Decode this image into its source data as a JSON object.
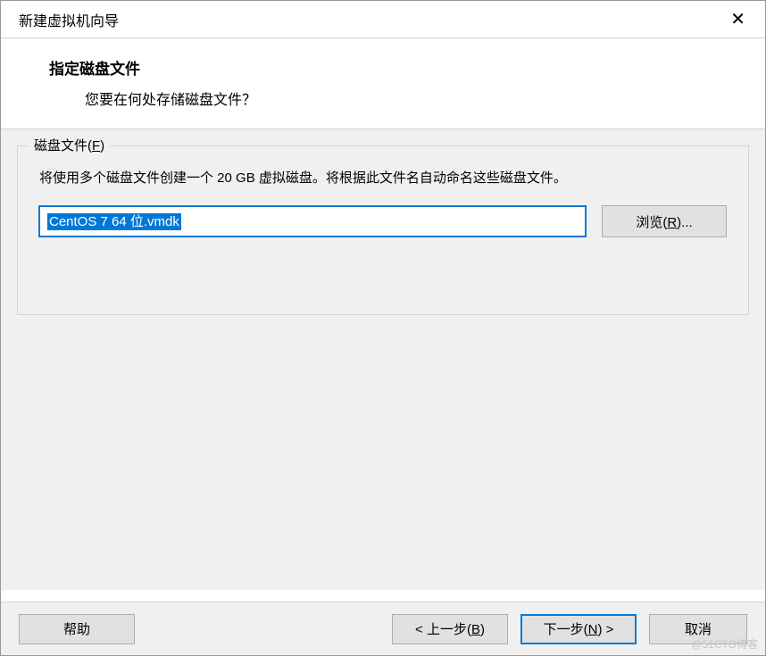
{
  "window": {
    "title": "新建虚拟机向导"
  },
  "header": {
    "title": "指定磁盘文件",
    "subtitle": "您要在何处存储磁盘文件？"
  },
  "group": {
    "label_prefix": "磁盘文件(",
    "label_key": "F",
    "label_suffix": ")",
    "description": "将使用多个磁盘文件创建一个 20 GB 虚拟磁盘。将根据此文件名自动命名这些磁盘文件。",
    "file_value": "CentOS 7 64 位.vmdk",
    "browse_prefix": "浏览(",
    "browse_key": "R",
    "browse_suffix": ")..."
  },
  "footer": {
    "help": "帮助",
    "back_prefix": "< 上一步(",
    "back_key": "B",
    "back_suffix": ")",
    "next_prefix": "下一步(",
    "next_key": "N",
    "next_suffix": ") >",
    "cancel": "取消"
  },
  "watermark": "@51CTO博客"
}
